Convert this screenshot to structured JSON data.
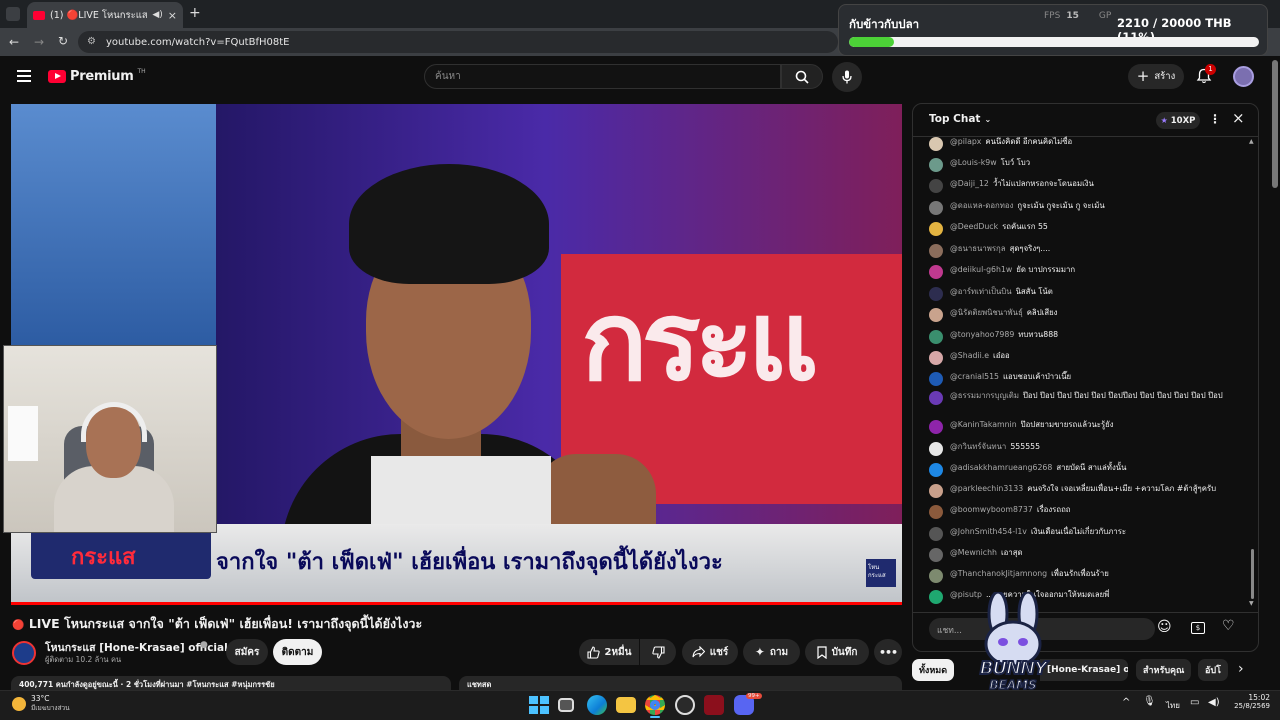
{
  "browser": {
    "tab_title": "(1) 🔴LIVE โหนกระแส จากใจ",
    "url": "youtube.com/watch?v=FQutBfH08tE",
    "new_tab": "+"
  },
  "overlay": {
    "label": "กับข้าวกับปลา",
    "amount": "2210 / 20000 THB (11%)",
    "progress": 0.11,
    "fps_label": "FPS",
    "fps_value": "15",
    "gpu_label": "GP"
  },
  "youtube": {
    "logo_text": "Premium",
    "logo_sup": "TH",
    "search_placeholder": "ค้นหา",
    "create_label": "สร้าง",
    "notif_count": "1"
  },
  "video": {
    "banner_logo": "กระแส",
    "caption": "จากใจ \"ต้า เฟ็ดเฟ่\" เฮ้ยเพื่อน เรามาถึงจุดนี้ได้ยังไงวะ",
    "corner_logo": "โหน กระแส",
    "bg_text": "กระแ",
    "live_dot": "🔴",
    "title": "LIVE โหนกระแส จากใจ \"ต้า เฟ็ดเฟ่\" เฮ้ยเพื่อน! เรามาถึงจุดนี้ได้ยังไงวะ",
    "channel_name": "โหนกระแส [Hone-Krasae] official",
    "subscribers": "ผู้ติดตาม 10.2 ล้าน คน",
    "join_label": "สมัคร",
    "subscribe_label": "ติดตาม",
    "like_count": "2หมื่น",
    "share_label": "แชร์",
    "ask_label": "ถาม",
    "save_label": "บันทึก",
    "desc_preview": "400,771 คนกำลังดูอยู่ขณะนี้ · 2 ชั่วโมงที่ผ่านมา  #โหนกระแส #หนุ่มกรรชัย",
    "desc_right": "แชทสด"
  },
  "chat": {
    "header": "Top Chat",
    "xp_badge": "10XP",
    "input_placeholder": "แชท...",
    "messages": [
      {
        "author": "@pilapx",
        "text": "คนนึงคิดดี อีกคนคิดไม่ซื่อ",
        "color": "#d9c7b0"
      },
      {
        "author": "@Louis-k9w",
        "text": "โบว์ โบว",
        "color": "#6c9a8b"
      },
      {
        "author": "@Daiji_12",
        "text": "ว้ำไม่แปลกหรอกจะโดนอมเงิน",
        "color": "#444"
      },
      {
        "author": "@ดอแหล-ดอกทอง",
        "text": "กูจะเม้น กูจะเม้น กู จะเม้น",
        "color": "#777"
      },
      {
        "author": "@DeedDuck",
        "text": "รถคันแรก 55",
        "color": "#e3b341"
      },
      {
        "author": "@ธนาธนาพรกุล",
        "text": "สุดๆจริงๆ....",
        "color": "#8b6d5c"
      },
      {
        "author": "@deiikul-g6h1w",
        "text": "ยัด บาปกรรมมาก",
        "color": "#c0398f"
      },
      {
        "author": "@อาร์ทเท่าเป็นบิน",
        "text": "นิสสัน โน้ต",
        "color": "#2d2d4f"
      },
      {
        "author": "@นิรัตติยพนิชนาพันธุ์",
        "text": "คลิปเสียง",
        "color": "#c9a38d"
      },
      {
        "author": "@tonyahoo7989",
        "text": "ทบทวน888",
        "color": "#3a8f6e"
      },
      {
        "author": "@Shadii.e",
        "text": "เอ๋ออ",
        "color": "#d6a7a7"
      },
      {
        "author": "@cranial515",
        "text": "แอบชอบเค้าป่าวเนี๊ย",
        "color": "#1e5bb5"
      },
      {
        "author": "@ธรรมมากรบุญเติม",
        "text": "ป๊อป ป๊อป ป๊อป ป๊อป ป๊อป ป๊อปป๊อป ป๊อป ป๊อป ป๊อป ป๊อป ป๊อป",
        "color": "#6a3ab5"
      },
      {
        "author": "@KaninTakamnin",
        "text": "ป๊อปสยามขายรถแล้วนะรู้ยัง",
        "color": "#8e24aa"
      },
      {
        "author": "@กวินทร์จันทนา",
        "text": "555555",
        "color": "#e6e6e6"
      },
      {
        "author": "@adisakkhamrueang6268",
        "text": "สายบัดนี สาแล่ทั้งนั้น",
        "color": "#1e88e5"
      },
      {
        "author": "@parkleechin3133",
        "text": "คนจริงใจ เจอเหลี่ยมเพื่อน+เมีย +ความโลภ #ต้าสู้ๆครับ",
        "color": "#c9a08b"
      },
      {
        "author": "@boomwyboom8737",
        "text": "เรื่องรถถถ",
        "color": "#8b5a3c"
      },
      {
        "author": "@JohnSmith454-l1v",
        "text": "เงินเดือนเนื่อไม่เกี่ยวกับภาระ",
        "color": "#555"
      },
      {
        "author": "@Mewnichh",
        "text": "เอาสุด",
        "color": "#666"
      },
      {
        "author": "@ThanchanokJitjamnong",
        "text": "เพื่อนรักเพื่อนร้าย",
        "color": "#7d8a6f"
      },
      {
        "author": "@pisutp",
        "text": "...ขายความในใจออกมาให้หมดเลยพี่",
        "color": "#1fa870"
      }
    ]
  },
  "chips": [
    "ทั้งหมด",
    "[Hone-Krasae] official",
    "สำหรับคุณ",
    "อัปโ"
  ],
  "watermark": {
    "line1": "BUNNY",
    "line2": "BEAMS"
  },
  "taskbar": {
    "temp": "33°C",
    "weather": "มีเมฆบางส่วน",
    "lang": "ไทย",
    "time": "15:02",
    "date": "25/8/2569",
    "discord_badge": "99+"
  }
}
